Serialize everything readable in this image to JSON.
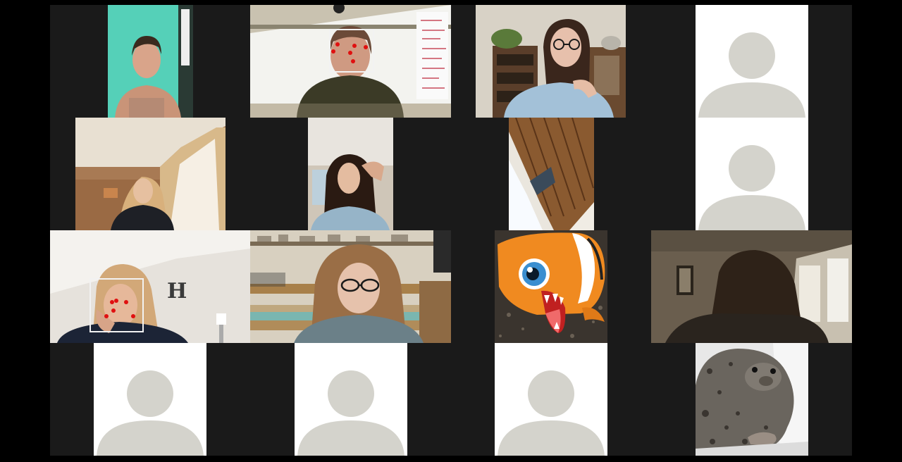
{
  "app": {
    "name": ""
  },
  "meeting": {
    "view": "gallery",
    "participant_count": 16
  },
  "colors": {
    "background": "#000000",
    "grid_background": "#1a1a1a",
    "avatar_tile": "#ffffff",
    "avatar_silhouette": "#d4d3cc",
    "face_marker": "#e01010",
    "face_box": "#f2f2f2"
  },
  "tiles": [
    {
      "id": 1,
      "kind": "video",
      "icon": "person-video"
    },
    {
      "id": 2,
      "kind": "video",
      "icon": "person-video",
      "face_detected": true
    },
    {
      "id": 3,
      "kind": "video",
      "icon": "person-video"
    },
    {
      "id": 4,
      "kind": "avatar",
      "icon": "avatar-placeholder-icon"
    },
    {
      "id": 5,
      "kind": "video",
      "icon": "person-video"
    },
    {
      "id": 6,
      "kind": "video",
      "icon": "person-video"
    },
    {
      "id": 7,
      "kind": "video",
      "icon": "ceiling-video"
    },
    {
      "id": 8,
      "kind": "avatar",
      "icon": "avatar-placeholder-icon"
    },
    {
      "id": 9,
      "kind": "video",
      "icon": "person-video",
      "face_detected": true
    },
    {
      "id": 10,
      "kind": "video",
      "icon": "person-video"
    },
    {
      "id": 11,
      "kind": "video",
      "icon": "plush-fish-video"
    },
    {
      "id": 12,
      "kind": "video",
      "icon": "person-video"
    },
    {
      "id": 13,
      "kind": "avatar",
      "icon": "avatar-placeholder-icon"
    },
    {
      "id": 14,
      "kind": "avatar",
      "icon": "avatar-placeholder-icon"
    },
    {
      "id": 15,
      "kind": "avatar",
      "icon": "avatar-placeholder-icon"
    },
    {
      "id": 16,
      "kind": "image",
      "icon": "seal-image"
    }
  ]
}
